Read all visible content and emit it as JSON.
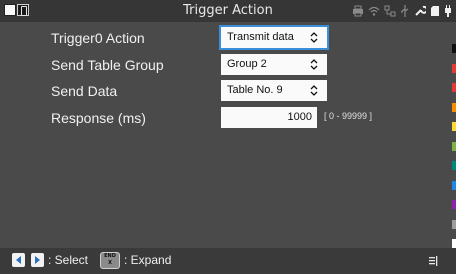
{
  "window": {
    "title": "Trigger Action"
  },
  "form": {
    "trigger_action_label": "Trigger0  Action",
    "trigger_action_value": "Transmit data",
    "send_table_group_label": "Send Table Group",
    "send_table_group_value": "Group 2",
    "send_data_label": "Send Data",
    "send_data_value": "Table No. 9",
    "response_label": "Response (ms)",
    "response_value": "1000",
    "response_range": "[ 0 - 99999 ]"
  },
  "channel_colors": [
    "#111111",
    "#e53935",
    "#e53935",
    "#fb8c00",
    "#fdd835",
    "#7cb342",
    "#00897b",
    "#1e88e5",
    "#8e24aa",
    "#9e9e9e",
    "#ffffff"
  ],
  "bottombar": {
    "select_hint": ": Select",
    "end_key_top": "END",
    "end_key_bottom": "X",
    "expand_hint": ": Expand"
  },
  "accent_color": "#3a8fd8",
  "icons": [
    "printer-icon",
    "wifi-icon",
    "network-icon",
    "usb-icon",
    "wrench-icon",
    "sd-card-icon",
    "power-plug-icon",
    "left-arrow-icon",
    "right-arrow-icon",
    "menu-icon"
  ]
}
